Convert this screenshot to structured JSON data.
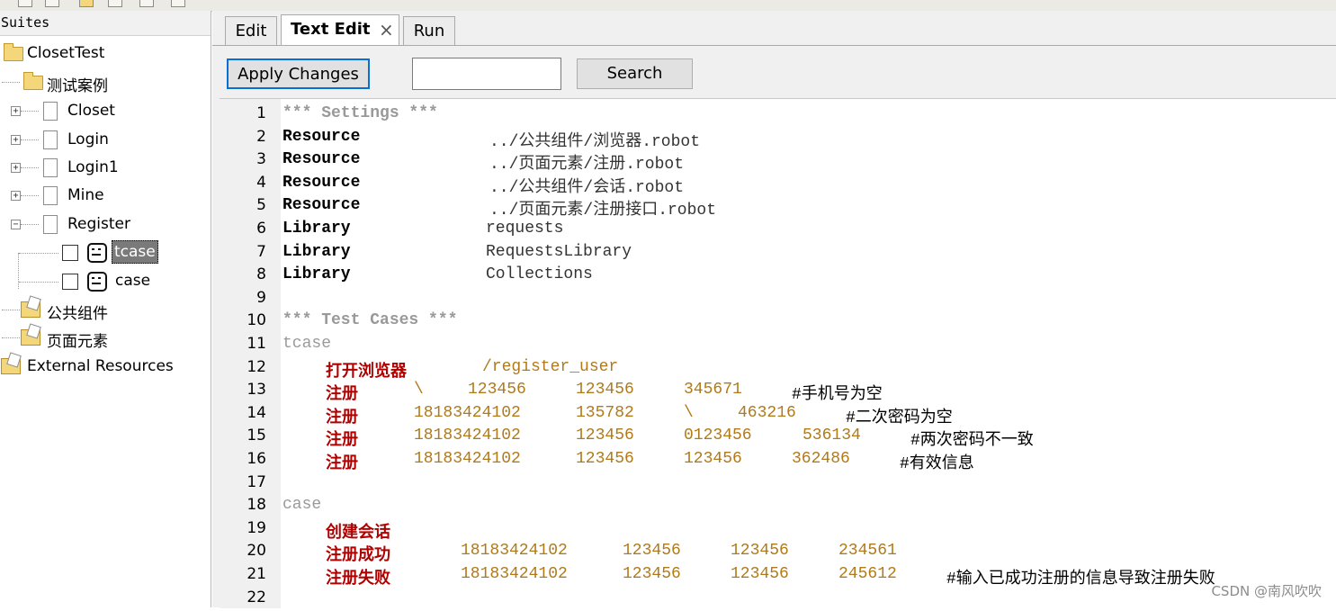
{
  "left_panel": {
    "header": "Suites",
    "tree": {
      "root": "ClosetTest",
      "folder_testcases": "测试案例",
      "files": [
        "Closet",
        "Login",
        "Login1",
        "Mine",
        "Register"
      ],
      "register_cases": [
        "tcase",
        "case"
      ],
      "folder_common": "公共组件",
      "folder_page": "页面元素",
      "external": "External Resources"
    }
  },
  "tabs": [
    {
      "label": "Edit",
      "active": false
    },
    {
      "label": "Text Edit",
      "active": true,
      "close": "×"
    },
    {
      "label": "Run",
      "active": false
    }
  ],
  "toolbar": {
    "apply_label": "Apply Changes",
    "search_value": "",
    "search_label": "Search"
  },
  "editor": {
    "line_numbers": [
      "1",
      "2",
      "3",
      "4",
      "5",
      "6",
      "7",
      "8",
      "9",
      "10",
      "11",
      "12",
      "13",
      "14",
      "15",
      "16",
      "17",
      "18",
      "19",
      "20",
      "21",
      "22"
    ],
    "lines": [
      {
        "tokens": [
          {
            "t": "*** Settings ***",
            "c": "header"
          }
        ]
      },
      {
        "tokens": [
          {
            "t": "Resource",
            "c": "setting"
          },
          {
            "t": "../公共组件/浏览器.robot",
            "c": "value"
          }
        ]
      },
      {
        "tokens": [
          {
            "t": "Resource",
            "c": "setting"
          },
          {
            "t": "../页面元素/注册.robot",
            "c": "value"
          }
        ]
      },
      {
        "tokens": [
          {
            "t": "Resource",
            "c": "setting"
          },
          {
            "t": "../公共组件/会话.robot",
            "c": "value"
          }
        ]
      },
      {
        "tokens": [
          {
            "t": "Resource",
            "c": "setting"
          },
          {
            "t": "../页面元素/注册接口.robot",
            "c": "value"
          }
        ]
      },
      {
        "tokens": [
          {
            "t": "Library",
            "c": "setting"
          },
          {
            "t": "requests",
            "c": "value"
          }
        ]
      },
      {
        "tokens": [
          {
            "t": "Library",
            "c": "setting"
          },
          {
            "t": "RequestsLibrary",
            "c": "value"
          }
        ]
      },
      {
        "tokens": [
          {
            "t": "Library",
            "c": "setting"
          },
          {
            "t": "Collections",
            "c": "value"
          }
        ]
      },
      {
        "tokens": []
      },
      {
        "tokens": [
          {
            "t": "*** Test Cases ***",
            "c": "header"
          }
        ]
      },
      {
        "tokens": [
          {
            "t": "tcase",
            "c": "testname"
          }
        ]
      },
      {
        "tokens": [
          {
            "t": "打开浏览器",
            "c": "keyword"
          },
          {
            "t": "/register_user",
            "c": "arg"
          }
        ]
      },
      {
        "tokens": [
          {
            "t": "注册",
            "c": "keyword"
          },
          {
            "t": "\\",
            "c": "arg"
          },
          {
            "t": "123456",
            "c": "arg"
          },
          {
            "t": "123456",
            "c": "arg"
          },
          {
            "t": "345671",
            "c": "arg"
          },
          {
            "t": "#手机号为空",
            "c": "comment"
          }
        ]
      },
      {
        "tokens": [
          {
            "t": "注册",
            "c": "keyword"
          },
          {
            "t": "18183424102",
            "c": "arg"
          },
          {
            "t": "135782",
            "c": "arg"
          },
          {
            "t": "\\",
            "c": "arg"
          },
          {
            "t": "463216",
            "c": "arg"
          },
          {
            "t": "#二次密码为空",
            "c": "comment"
          }
        ]
      },
      {
        "tokens": [
          {
            "t": "注册",
            "c": "keyword"
          },
          {
            "t": "18183424102",
            "c": "arg"
          },
          {
            "t": "123456",
            "c": "arg"
          },
          {
            "t": "0123456",
            "c": "arg"
          },
          {
            "t": "536134",
            "c": "arg"
          },
          {
            "t": "#两次密码不一致",
            "c": "comment"
          }
        ]
      },
      {
        "tokens": [
          {
            "t": "注册",
            "c": "keyword"
          },
          {
            "t": "18183424102",
            "c": "arg"
          },
          {
            "t": "123456",
            "c": "arg"
          },
          {
            "t": "123456",
            "c": "arg"
          },
          {
            "t": "362486",
            "c": "arg"
          },
          {
            "t": "#有效信息",
            "c": "comment"
          }
        ]
      },
      {
        "tokens": []
      },
      {
        "tokens": [
          {
            "t": "case",
            "c": "testname"
          }
        ]
      },
      {
        "tokens": [
          {
            "t": "创建会话",
            "c": "keyword"
          }
        ]
      },
      {
        "tokens": [
          {
            "t": "注册成功",
            "c": "keyword"
          },
          {
            "t": "18183424102",
            "c": "arg"
          },
          {
            "t": "123456",
            "c": "arg"
          },
          {
            "t": "123456",
            "c": "arg"
          },
          {
            "t": "234561",
            "c": "arg"
          }
        ]
      },
      {
        "tokens": [
          {
            "t": "注册失败",
            "c": "keyword"
          },
          {
            "t": "18183424102",
            "c": "arg"
          },
          {
            "t": "123456",
            "c": "arg"
          },
          {
            "t": "123456",
            "c": "arg"
          },
          {
            "t": "245612",
            "c": "arg"
          },
          {
            "t": "#输入已成功注册的信息导致注册失败",
            "c": "comment"
          }
        ]
      },
      {
        "tokens": []
      }
    ]
  },
  "watermark": "CSDN @南风吹吹"
}
